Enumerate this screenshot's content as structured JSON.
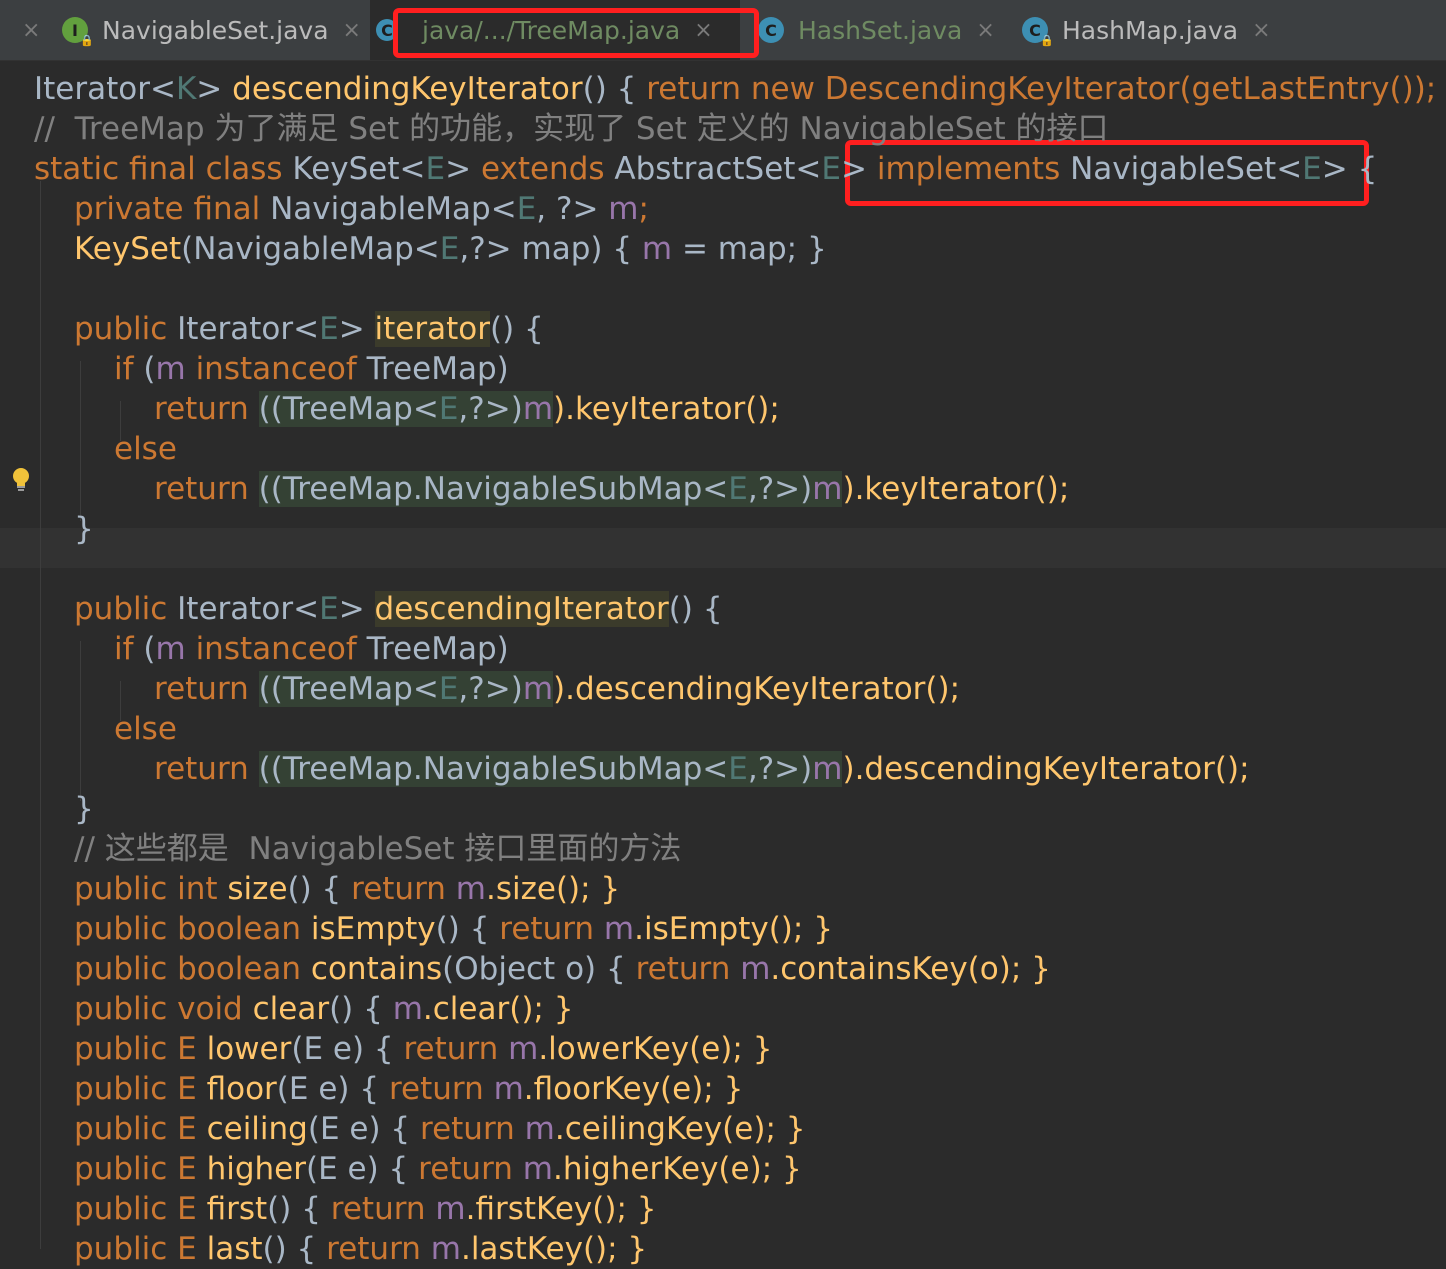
{
  "tabs": [
    {
      "label": "NavigableSet.java",
      "icon": "interface-icon",
      "active": false
    },
    {
      "label": "java/.../TreeMap.java",
      "icon": "class-icon",
      "active": true
    },
    {
      "label": "HashSet.java",
      "icon": "class-icon",
      "active": false
    },
    {
      "label": "HashMap.java",
      "icon": "class-icon",
      "active": false
    }
  ],
  "icon_letters": {
    "interface": "I",
    "class": "C"
  },
  "close_glyph": "×",
  "colors": {
    "keyword": "#cc7832",
    "method": "#ffc66d",
    "field": "#9876aa",
    "comment": "#808080",
    "annotation_box": "#ff1f1f"
  },
  "code": {
    "l1": [
      "Iterator<",
      "K",
      "> ",
      "descendingKeyIterator",
      "() { ",
      "return new DescendingKeyIterator(getLastEntry());",
      " }"
    ],
    "comment1": "//  TreeMap 为了满足 Set 的功能，实现了 Set 定义的 NavigableSet 的接口",
    "l3a": "static final class ",
    "l3b": "KeySet<",
    "l3c": "E",
    "l3d": "> ",
    "l3e": "extends ",
    "l3f": "AbstractSet<",
    "l3g": "E",
    "l3h": "> ",
    "l3i": "implements ",
    "l3j": "NavigableSet<",
    "l3k": "E",
    "l3l": "> {",
    "l4a": "private final ",
    "l4b": "NavigableMap<",
    "l4c": "E",
    "l4d": ", ?> ",
    "l4e": "m",
    "l4f": ";",
    "l5a": "KeySet",
    "l5b": "(NavigableMap<",
    "l5c": "E",
    "l5d": ",?> map) { ",
    "l5e": "m",
    "l5f": " = map; }",
    "iter_sig_a": "public ",
    "iter_sig_b": "Iterator<",
    "iter_sig_c": "E",
    "iter_sig_d": "> ",
    "iter_sig_e": "iterator",
    "iter_sig_f": "() {",
    "if_a": "if ",
    "if_b": "(",
    "if_c": "m",
    "if_d": " ",
    "if_e": "instanceof ",
    "if_f": "TreeMap)",
    "ret": "return ",
    "cast1a": "((TreeMap<",
    "cast1b": "E",
    "cast1c": ",?>)",
    "cast_m": "m",
    "keyIter": ").keyIterator();",
    "else": "else",
    "cast2a": "((TreeMap.NavigableSubMap<",
    "cast2b": "E",
    "cast2c": ",?>)",
    "close": "}",
    "desc_sig_e": "descendingIterator",
    "descIter": ").descendingKeyIterator();",
    "comment2": "// 这些都是  NavigableSet 接口里面的方法",
    "methods": [
      [
        "public int ",
        "size",
        "() { ",
        "return ",
        "m",
        ".size(); }"
      ],
      [
        "public boolean ",
        "isEmpty",
        "() { ",
        "return ",
        "m",
        ".isEmpty(); }"
      ],
      [
        "public boolean ",
        "contains",
        "(Object o) { ",
        "return ",
        "m",
        ".containsKey(o); }"
      ],
      [
        "public void ",
        "clear",
        "() { ",
        "",
        "m",
        ".clear(); }"
      ],
      [
        "public E ",
        "lower",
        "(E e) { ",
        "return ",
        "m",
        ".lowerKey(e); }"
      ],
      [
        "public E ",
        "floor",
        "(E e) { ",
        "return ",
        "m",
        ".floorKey(e); }"
      ],
      [
        "public E ",
        "ceiling",
        "(E e) { ",
        "return ",
        "m",
        ".ceilingKey(e); }"
      ],
      [
        "public E ",
        "higher",
        "(E e) { ",
        "return ",
        "m",
        ".higherKey(e); }"
      ],
      [
        "public E ",
        "first",
        "() { ",
        "return ",
        "m",
        ".firstKey(); }"
      ],
      [
        "public E ",
        "last",
        "() { ",
        "return ",
        "m",
        ".lastKey(); }"
      ]
    ]
  }
}
